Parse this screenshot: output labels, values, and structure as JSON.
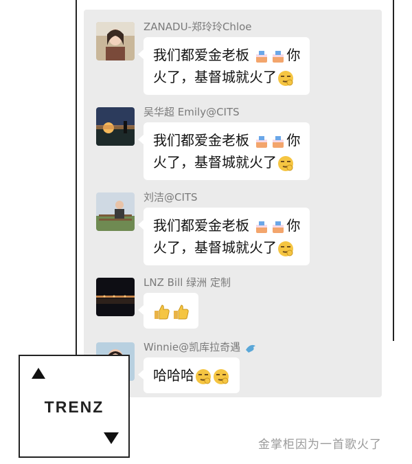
{
  "messages": [
    {
      "sender": "ZANADU-郑玲玲Chloe",
      "line1": "我们都爱金老板",
      "line1_tail": "你",
      "line2": "火了，基督城就火了",
      "avatar_icon": "woman-avatar"
    },
    {
      "sender": "吴华超 Emily@CITS",
      "line1": "我们都爱金老板",
      "line1_tail": "你",
      "line2": "火了，基督城就火了",
      "avatar_icon": "sunset-avatar"
    },
    {
      "sender": "刘洁@CITS",
      "line1": "我们都爱金老板",
      "line1_tail": "你",
      "line2": "火了，基督城就火了",
      "avatar_icon": "person-fence-avatar"
    },
    {
      "sender": "LNZ Bill 绿洲 定制",
      "thumbs": "thumbs-up-icon",
      "avatar_icon": "night-lake-avatar"
    },
    {
      "sender": "Winnie@凯库拉奇遇",
      "text": "哈哈哈",
      "avatar_icon": "woman-red-avatar"
    }
  ],
  "logo": {
    "text": "TRENZ"
  },
  "caption": "金掌柜因为一首歌火了",
  "colors": {
    "panel": "#ebebeb",
    "bubble": "#ffffff",
    "sender": "#7a7a7a"
  }
}
